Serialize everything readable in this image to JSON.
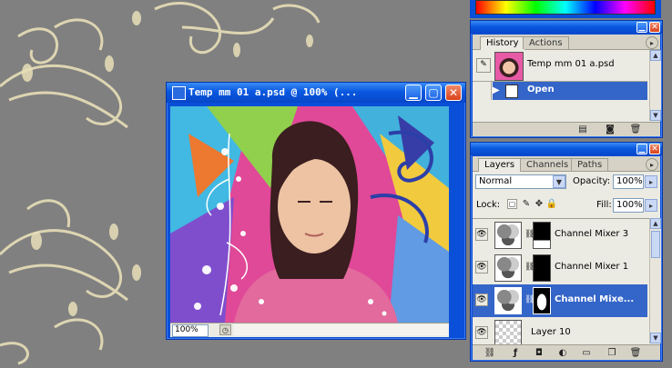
{
  "document_window": {
    "title": "Temp mm 01 a.psd @ 100% (...",
    "zoom": "100%"
  },
  "history_panel": {
    "tabs": [
      {
        "label": "History",
        "active": true
      },
      {
        "label": "Actions",
        "active": false
      }
    ],
    "snapshot_label": "Temp mm 01 a.psd",
    "steps": [
      {
        "label": "Open",
        "selected": true
      }
    ]
  },
  "layers_panel": {
    "tabs": [
      {
        "label": "Layers",
        "active": true
      },
      {
        "label": "Channels",
        "active": false
      },
      {
        "label": "Paths",
        "active": false
      }
    ],
    "blend_mode": "Normal",
    "opacity_label": "Opacity:",
    "opacity": "100%",
    "lock_label": "Lock:",
    "fill_label": "Fill:",
    "fill": "100%",
    "layers": [
      {
        "name": "Channel Mixer 3",
        "selected": false
      },
      {
        "name": "Channel Mixer 1",
        "selected": false
      },
      {
        "name": "Channel Mixe...",
        "selected": true
      },
      {
        "name": "Layer 10",
        "selected": false
      }
    ]
  },
  "colors": {
    "title_blue": "#0a58e0",
    "selection_blue": "#3465c8",
    "desktop_gray": "#808080"
  }
}
